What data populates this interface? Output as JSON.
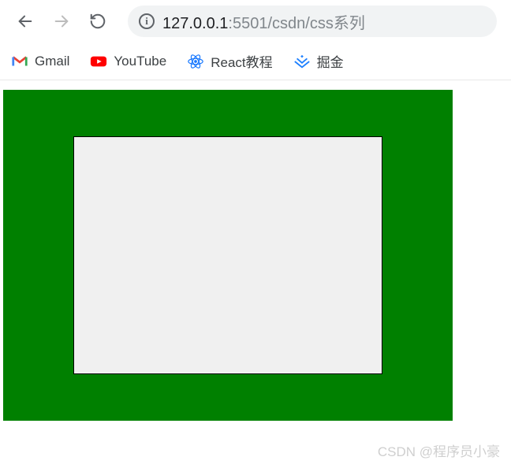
{
  "url": {
    "host": "127.0.0.1",
    "port": ":5501",
    "path": "/csdn/css系列"
  },
  "bookmarks": {
    "gmail": "Gmail",
    "youtube": "YouTube",
    "react": "React教程",
    "juejin": "掘金"
  },
  "watermark": "CSDN @程序员小豪"
}
